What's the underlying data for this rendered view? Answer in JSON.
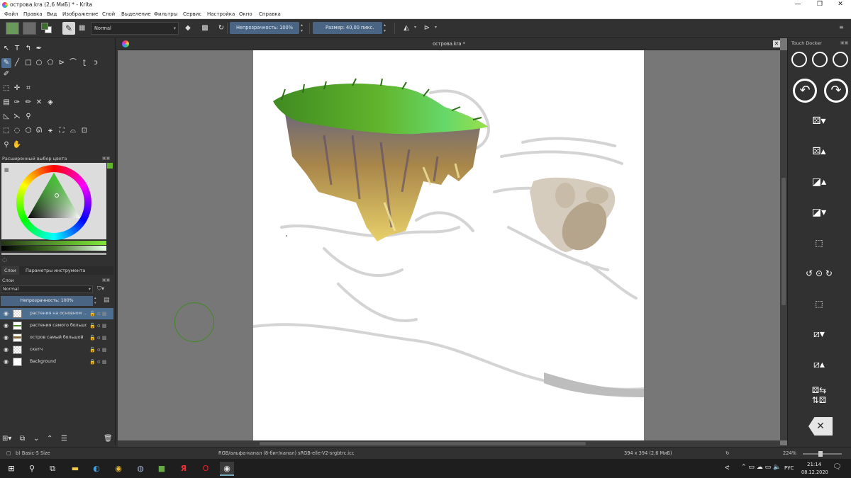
{
  "window": {
    "title": "острова.kra (2,6 МиБ)  * - Krita",
    "minimize": "—",
    "maximize": "❐",
    "close": "✕"
  },
  "menu": [
    "Файл",
    "Правка",
    "Вид",
    "Изображение",
    "Слой",
    "Выделение",
    "Фильтры",
    "Сервис",
    "Настройка",
    "Окно",
    "Справка"
  ],
  "toolbar": {
    "blend_mode": "Normal",
    "opacity": "Непрозрачность: 100%",
    "size": "Размер: 40,00 пикс."
  },
  "doc": {
    "tab": "острова.kra *"
  },
  "color_selector": {
    "title": "Расширенный выбор цвета"
  },
  "layers_panel": {
    "tabs": [
      "Слои",
      "Параметры инструмента"
    ],
    "title": "Слои",
    "blend_mode": "Normal",
    "opacity": "Непрозрачность:  100%",
    "layers": [
      {
        "name": "растения на основном ...",
        "selected": true
      },
      {
        "name": "растения самого большо...",
        "selected": false
      },
      {
        "name": "остров самый большой",
        "selected": false
      },
      {
        "name": "скетч",
        "selected": false
      },
      {
        "name": "Background",
        "selected": false
      }
    ]
  },
  "touch_docker": {
    "title": "Touch Docker"
  },
  "status": {
    "brush": "b) Basic-5 Size",
    "color_space": "RGB/альфа-канал (8-бит/канал)  sRGB-elle-V2-srgbtrc.icc",
    "image_size": "394 x 394 (2,6 МиБ)",
    "zoom": "224%"
  },
  "taskbar": {
    "lang": "РУС",
    "time": "21:14",
    "date": "08.12.2020"
  },
  "colors": {
    "accent": "#4b6e91",
    "field": "#4a6583",
    "grass": "#62b52c",
    "rock": "#a8864a"
  }
}
